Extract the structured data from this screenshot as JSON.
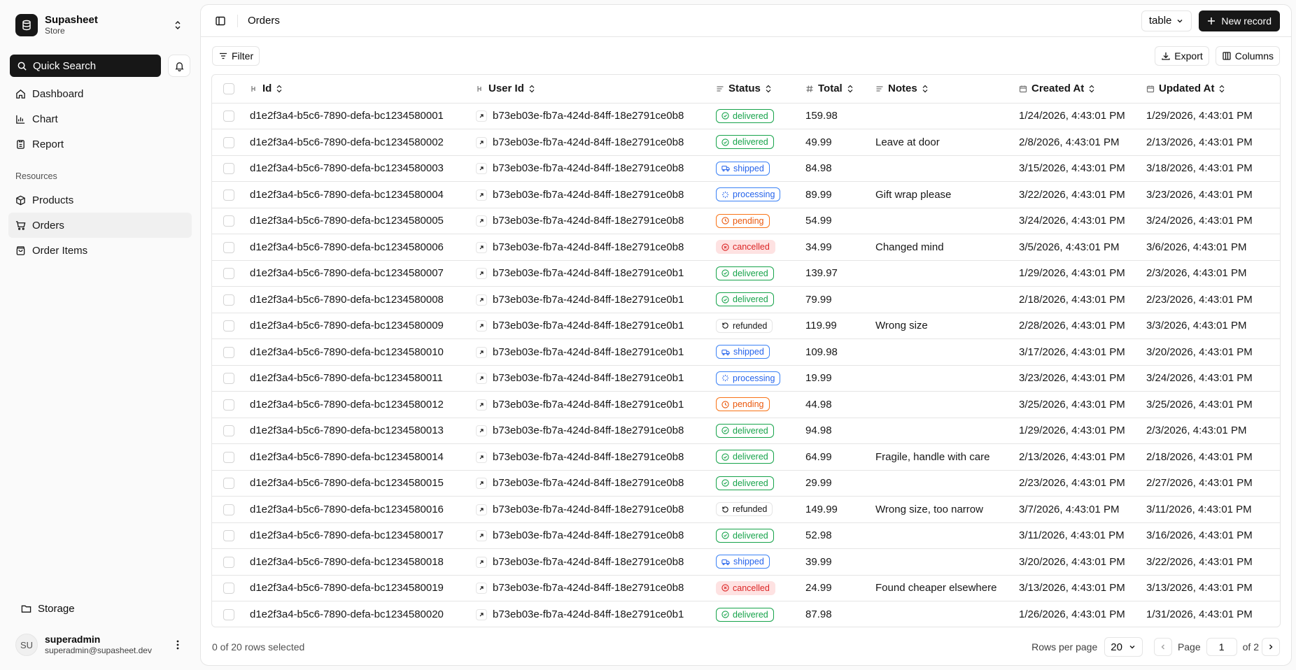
{
  "brand": {
    "name": "Supasheet",
    "subtitle": "Store"
  },
  "search": {
    "label": "Quick Search"
  },
  "nav": {
    "main": [
      {
        "label": "Dashboard",
        "icon": "home-icon"
      },
      {
        "label": "Chart",
        "icon": "chart-icon"
      },
      {
        "label": "Report",
        "icon": "report-icon"
      }
    ],
    "group_label": "Resources",
    "resources": [
      {
        "label": "Products",
        "icon": "box-icon"
      },
      {
        "label": "Orders",
        "icon": "cart-icon",
        "active": true
      },
      {
        "label": "Order Items",
        "icon": "bag-icon"
      }
    ],
    "storage": "Storage"
  },
  "user": {
    "initials": "SU",
    "name": "superadmin",
    "email": "superadmin@supasheet.dev"
  },
  "header": {
    "title": "Orders",
    "view": "table",
    "new_record": "New record"
  },
  "toolbar": {
    "filter": "Filter",
    "export": "Export",
    "columns": "Columns"
  },
  "table": {
    "columns": [
      "Id",
      "User Id",
      "Status",
      "Total",
      "Notes",
      "Created At",
      "Updated At"
    ],
    "rows": [
      {
        "id": "d1e2f3a4-b5c6-7890-defa-bc1234580001",
        "user_id": "b73eb03e-fb7a-424d-84ff-18e2791ce0b8",
        "status": "delivered",
        "total": "159.98",
        "notes": "",
        "created": "1/24/2026, 4:43:01 PM",
        "updated": "1/29/2026, 4:43:01 PM"
      },
      {
        "id": "d1e2f3a4-b5c6-7890-defa-bc1234580002",
        "user_id": "b73eb03e-fb7a-424d-84ff-18e2791ce0b8",
        "status": "delivered",
        "total": "49.99",
        "notes": "Leave at door",
        "created": "2/8/2026, 4:43:01 PM",
        "updated": "2/13/2026, 4:43:01 PM"
      },
      {
        "id": "d1e2f3a4-b5c6-7890-defa-bc1234580003",
        "user_id": "b73eb03e-fb7a-424d-84ff-18e2791ce0b8",
        "status": "shipped",
        "total": "84.98",
        "notes": "",
        "created": "3/15/2026, 4:43:01 PM",
        "updated": "3/18/2026, 4:43:01 PM"
      },
      {
        "id": "d1e2f3a4-b5c6-7890-defa-bc1234580004",
        "user_id": "b73eb03e-fb7a-424d-84ff-18e2791ce0b8",
        "status": "processing",
        "total": "89.99",
        "notes": "Gift wrap please",
        "created": "3/22/2026, 4:43:01 PM",
        "updated": "3/23/2026, 4:43:01 PM"
      },
      {
        "id": "d1e2f3a4-b5c6-7890-defa-bc1234580005",
        "user_id": "b73eb03e-fb7a-424d-84ff-18e2791ce0b8",
        "status": "pending",
        "total": "54.99",
        "notes": "",
        "created": "3/24/2026, 4:43:01 PM",
        "updated": "3/24/2026, 4:43:01 PM"
      },
      {
        "id": "d1e2f3a4-b5c6-7890-defa-bc1234580006",
        "user_id": "b73eb03e-fb7a-424d-84ff-18e2791ce0b8",
        "status": "cancelled",
        "total": "34.99",
        "notes": "Changed mind",
        "created": "3/5/2026, 4:43:01 PM",
        "updated": "3/6/2026, 4:43:01 PM"
      },
      {
        "id": "d1e2f3a4-b5c6-7890-defa-bc1234580007",
        "user_id": "b73eb03e-fb7a-424d-84ff-18e2791ce0b1",
        "status": "delivered",
        "total": "139.97",
        "notes": "",
        "created": "1/29/2026, 4:43:01 PM",
        "updated": "2/3/2026, 4:43:01 PM"
      },
      {
        "id": "d1e2f3a4-b5c6-7890-defa-bc1234580008",
        "user_id": "b73eb03e-fb7a-424d-84ff-18e2791ce0b1",
        "status": "delivered",
        "total": "79.99",
        "notes": "",
        "created": "2/18/2026, 4:43:01 PM",
        "updated": "2/23/2026, 4:43:01 PM"
      },
      {
        "id": "d1e2f3a4-b5c6-7890-defa-bc1234580009",
        "user_id": "b73eb03e-fb7a-424d-84ff-18e2791ce0b1",
        "status": "refunded",
        "total": "119.99",
        "notes": "Wrong size",
        "created": "2/28/2026, 4:43:01 PM",
        "updated": "3/3/2026, 4:43:01 PM"
      },
      {
        "id": "d1e2f3a4-b5c6-7890-defa-bc1234580010",
        "user_id": "b73eb03e-fb7a-424d-84ff-18e2791ce0b1",
        "status": "shipped",
        "total": "109.98",
        "notes": "",
        "created": "3/17/2026, 4:43:01 PM",
        "updated": "3/20/2026, 4:43:01 PM"
      },
      {
        "id": "d1e2f3a4-b5c6-7890-defa-bc1234580011",
        "user_id": "b73eb03e-fb7a-424d-84ff-18e2791ce0b1",
        "status": "processing",
        "total": "19.99",
        "notes": "",
        "created": "3/23/2026, 4:43:01 PM",
        "updated": "3/24/2026, 4:43:01 PM"
      },
      {
        "id": "d1e2f3a4-b5c6-7890-defa-bc1234580012",
        "user_id": "b73eb03e-fb7a-424d-84ff-18e2791ce0b1",
        "status": "pending",
        "total": "44.98",
        "notes": "",
        "created": "3/25/2026, 4:43:01 PM",
        "updated": "3/25/2026, 4:43:01 PM"
      },
      {
        "id": "d1e2f3a4-b5c6-7890-defa-bc1234580013",
        "user_id": "b73eb03e-fb7a-424d-84ff-18e2791ce0b8",
        "status": "delivered",
        "total": "94.98",
        "notes": "",
        "created": "1/29/2026, 4:43:01 PM",
        "updated": "2/3/2026, 4:43:01 PM"
      },
      {
        "id": "d1e2f3a4-b5c6-7890-defa-bc1234580014",
        "user_id": "b73eb03e-fb7a-424d-84ff-18e2791ce0b8",
        "status": "delivered",
        "total": "64.99",
        "notes": "Fragile, handle with care",
        "created": "2/13/2026, 4:43:01 PM",
        "updated": "2/18/2026, 4:43:01 PM"
      },
      {
        "id": "d1e2f3a4-b5c6-7890-defa-bc1234580015",
        "user_id": "b73eb03e-fb7a-424d-84ff-18e2791ce0b8",
        "status": "delivered",
        "total": "29.99",
        "notes": "",
        "created": "2/23/2026, 4:43:01 PM",
        "updated": "2/27/2026, 4:43:01 PM"
      },
      {
        "id": "d1e2f3a4-b5c6-7890-defa-bc1234580016",
        "user_id": "b73eb03e-fb7a-424d-84ff-18e2791ce0b8",
        "status": "refunded",
        "total": "149.99",
        "notes": "Wrong size, too narrow",
        "created": "3/7/2026, 4:43:01 PM",
        "updated": "3/11/2026, 4:43:01 PM"
      },
      {
        "id": "d1e2f3a4-b5c6-7890-defa-bc1234580017",
        "user_id": "b73eb03e-fb7a-424d-84ff-18e2791ce0b8",
        "status": "delivered",
        "total": "52.98",
        "notes": "",
        "created": "3/11/2026, 4:43:01 PM",
        "updated": "3/16/2026, 4:43:01 PM"
      },
      {
        "id": "d1e2f3a4-b5c6-7890-defa-bc1234580018",
        "user_id": "b73eb03e-fb7a-424d-84ff-18e2791ce0b8",
        "status": "shipped",
        "total": "39.99",
        "notes": "",
        "created": "3/20/2026, 4:43:01 PM",
        "updated": "3/22/2026, 4:43:01 PM"
      },
      {
        "id": "d1e2f3a4-b5c6-7890-defa-bc1234580019",
        "user_id": "b73eb03e-fb7a-424d-84ff-18e2791ce0b8",
        "status": "cancelled",
        "total": "24.99",
        "notes": "Found cheaper elsewhere",
        "created": "3/13/2026, 4:43:01 PM",
        "updated": "3/13/2026, 4:43:01 PM"
      },
      {
        "id": "d1e2f3a4-b5c6-7890-defa-bc1234580020",
        "user_id": "b73eb03e-fb7a-424d-84ff-18e2791ce0b1",
        "status": "delivered",
        "total": "87.98",
        "notes": "",
        "created": "1/26/2026, 4:43:01 PM",
        "updated": "1/31/2026, 4:43:01 PM"
      }
    ]
  },
  "footer": {
    "selection": "0 of 20 rows selected",
    "rows_per_page_label": "Rows per page",
    "rows_per_page": "20",
    "page_label": "Page",
    "page": "1",
    "of_pages": "of 2"
  },
  "colors": {
    "primary": "#171717",
    "delivered": "#16a34a",
    "shipped": "#2563eb",
    "pending": "#ea580c",
    "cancelled": "#dc2626"
  }
}
